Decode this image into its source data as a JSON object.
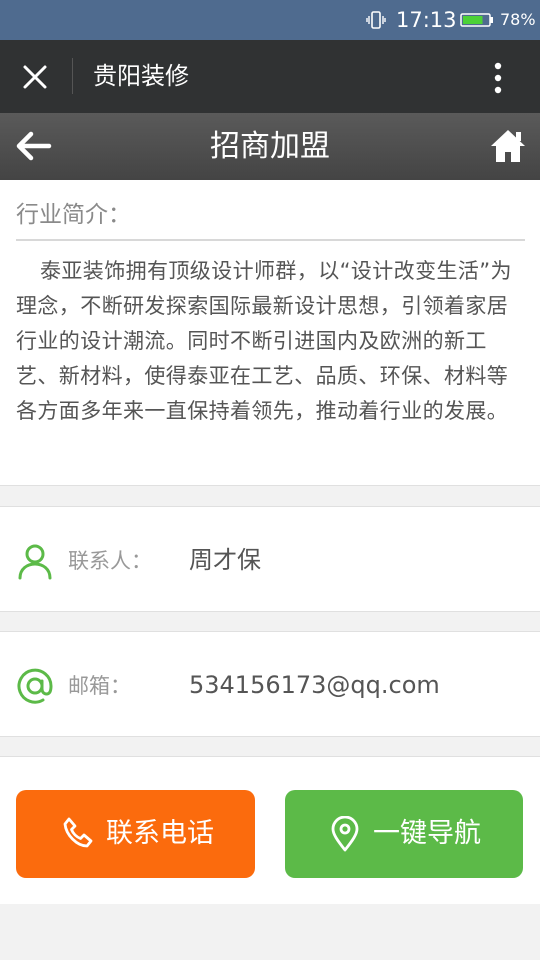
{
  "status_bar": {
    "time": "17:13",
    "battery": "78%",
    "battery_level": 0.78
  },
  "app_bar": {
    "title": "贵阳装修"
  },
  "page_header": {
    "title": "招商加盟"
  },
  "intro": {
    "label": "行业简介：",
    "body": "泰亚装饰拥有顶级设计师群，以“设计改变生活”为理念，不断研发探索国际最新设计思想，引领着家居行业的设计潮流。同时不断引进国内及欧洲的新工艺、新材料，使得泰亚在工艺、品质、环保、材料等各方面多年来一直保持着领先，推动着行业的发展。"
  },
  "contact": {
    "label": "联系人：",
    "value": "周才保"
  },
  "email": {
    "label": "邮箱：",
    "value": "534156173@qq.com"
  },
  "actions": {
    "call_label": "联系电话",
    "nav_label": "一键导航"
  },
  "colors": {
    "accent_green": "#5cba48",
    "accent_orange": "#fb6b0d",
    "header_dark": "#303233",
    "status_blue": "#4f6b8f"
  },
  "icons": [
    "vibrate-icon",
    "battery-icon",
    "close-icon",
    "more-vertical-icon",
    "back-arrow-icon",
    "home-icon",
    "person-icon",
    "at-icon",
    "phone-icon",
    "location-pin-icon"
  ]
}
